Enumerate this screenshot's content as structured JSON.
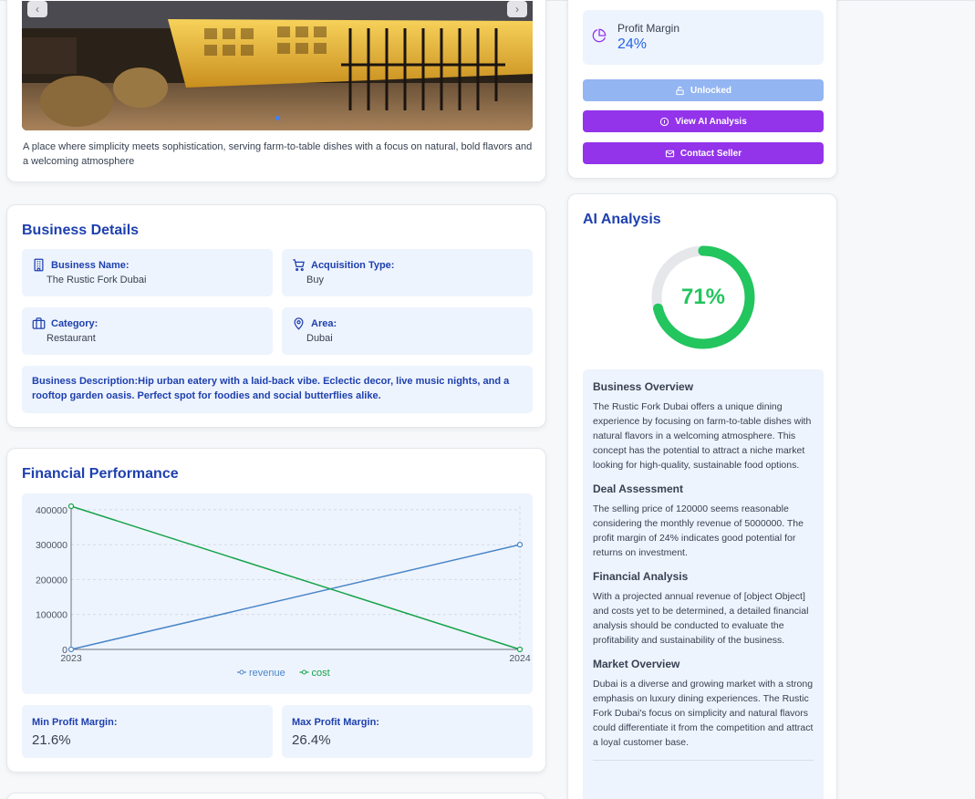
{
  "gallery": {
    "prev": "‹",
    "next": "›",
    "description": "A place where simplicity meets sophistication, serving farm-to-table dishes with a focus on natural, bold flavors and a welcoming atmosphere"
  },
  "sidebar": {
    "profit_margin_label": "Profit Margin",
    "profit_margin_value": "24%",
    "unlocked_label": "Unlocked",
    "view_ai_label": "View AI Analysis",
    "contact_label": "Contact Seller"
  },
  "details": {
    "title": "Business Details",
    "name_label": "Business Name:",
    "name_value": "The Rustic Fork Dubai",
    "acq_label": "Acquisition Type:",
    "acq_value": "Buy",
    "cat_label": "Category:",
    "cat_value": "Restaurant",
    "area_label": "Area:",
    "area_value": "Dubai",
    "description": "Business Description:Hip urban eatery with a laid-back vibe. Eclectic decor, live music nights, and a rooftop garden oasis. Perfect spot for foodies and social butterflies alike."
  },
  "financial": {
    "title": "Financial Performance",
    "min_label": "Min Profit Margin:",
    "min_value": "21.6%",
    "max_label": "Max Profit Margin:",
    "max_value": "26.4%"
  },
  "chart_data": {
    "type": "line",
    "x": [
      "2023",
      "2024"
    ],
    "series": [
      {
        "name": "revenue",
        "values": [
          0,
          300000
        ],
        "color": "#4a86c8"
      },
      {
        "name": "cost",
        "values": [
          410000,
          0
        ],
        "color": "#16a34a"
      }
    ],
    "yticks": [
      "400000",
      "300000",
      "200000",
      "100000",
      "0"
    ],
    "ylim": [
      0,
      410000
    ],
    "grid": true,
    "legend": "bottom"
  },
  "ai": {
    "title": "AI Analysis",
    "score": "71%",
    "score_value": 71,
    "sections": [
      {
        "heading": "Business Overview",
        "text": "The Rustic Fork Dubai offers a unique dining experience by focusing on farm-to-table dishes with natural flavors in a welcoming atmosphere. This concept has the potential to attract a niche market looking for high-quality, sustainable food options."
      },
      {
        "heading": "Deal Assessment",
        "text": "The selling price of 120000 seems reasonable considering the monthly revenue of 5000000. The profit margin of 24% indicates good potential for returns on investment."
      },
      {
        "heading": "Financial Analysis",
        "text": "With a projected annual revenue of [object Object] and costs yet to be determined, a detailed financial analysis should be conducted to evaluate the profitability and sustainability of the business."
      },
      {
        "heading": "Market Overview",
        "text": "Dubai is a diverse and growing market with a strong emphasis on luxury dining experiences. The Rustic Fork Dubai's focus on simplicity and natural flavors could differentiate it from the competition and attract a loyal customer base."
      }
    ]
  },
  "colors": {
    "accent": "#1e40af",
    "purple": "#9333ea",
    "gauge": "#22c55e"
  }
}
